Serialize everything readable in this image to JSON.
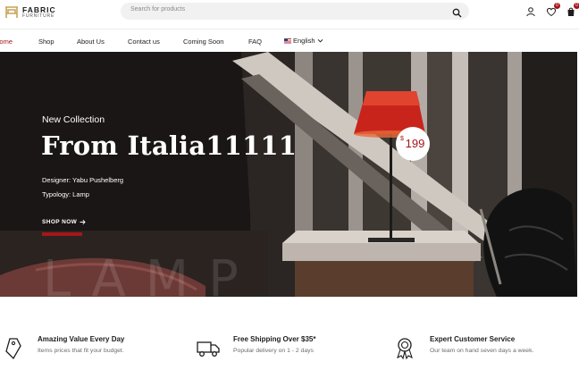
{
  "header": {
    "logo": {
      "title": "FABRIC",
      "subtitle": "FURNITURE"
    },
    "search": {
      "placeholder": "Search for products"
    },
    "icons": [
      "account-icon",
      "wishlist-icon",
      "cart-icon"
    ],
    "wishlist_badge": "0",
    "cart_badge": "0"
  },
  "nav": {
    "items": [
      {
        "label": "Home",
        "active": true
      },
      {
        "label": "Shop"
      },
      {
        "label": "About Us"
      },
      {
        "label": "Contact us"
      },
      {
        "label": "Coming Soon"
      },
      {
        "label": "FAQ"
      }
    ],
    "language": "English"
  },
  "hero": {
    "subtitle": "New Collection",
    "title": "From Italia11111",
    "designer": "Designer: Yabu Pushelberg",
    "typology": "Typology: Lamp",
    "cta": "SHOP NOW",
    "watermark": "LAMP",
    "price_currency": "$",
    "price_value": "199"
  },
  "features": [
    {
      "icon": "price-tag-icon",
      "title": "Amazing Value Every Day",
      "desc": "Items prices that fit your budget."
    },
    {
      "icon": "delivery-truck-icon",
      "title": "Free Shipping Over $35*",
      "desc": "Popular delivery on 1 - 2 days"
    },
    {
      "icon": "award-badge-icon",
      "title": "Expert Customer Service",
      "desc": "Our team on hand seven days a week."
    }
  ],
  "colors": {
    "accent": "#a3161a",
    "lamp_shade": "#c8241c"
  }
}
